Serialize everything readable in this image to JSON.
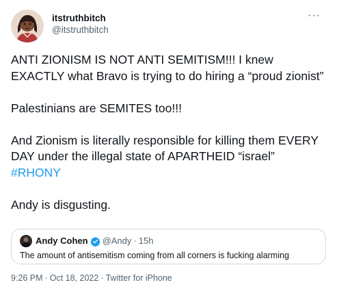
{
  "author": {
    "display_name": "itstruthbitch",
    "handle": "@itstruthbitch"
  },
  "more_label": "···",
  "tweet": {
    "line1": "ANTI ZIONISM IS NOT ANTI SEMITISM!!! I knew EXACTLY what Bravo is trying to do hiring a “proud zionist”",
    "line2": "Palestinians are SEMITES too!!!",
    "line3_pre": "And Zionism is literally responsible for killing them EVERY DAY under the illegal state of APARTHEID “israel” ",
    "hashtag": "#RHONY",
    "line4": "Andy is disgusting."
  },
  "quote": {
    "name": "Andy Cohen",
    "handle": "@Andy",
    "dot": "·",
    "time": "15h",
    "text": "The amount of antisemitism coming from all corners is fucking alarming"
  },
  "meta": {
    "time": "9:26 PM",
    "date": "Oct 18, 2022",
    "source": "Twitter for iPhone",
    "sep": "·"
  },
  "colors": {
    "link": "#1d9bf0",
    "secondary": "#536471",
    "border": "#cfd9de"
  }
}
